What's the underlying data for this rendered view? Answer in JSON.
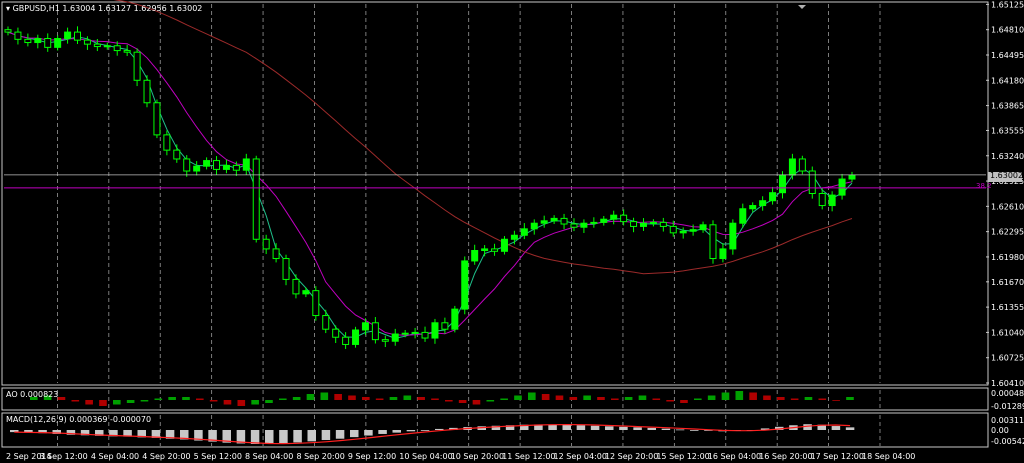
{
  "chart_header": {
    "symbol_label": "GBPUSD,H1",
    "open": "1.63004",
    "high": "1.63127",
    "low": "1.62956",
    "close": "1.63002"
  },
  "price_axis": {
    "ticks": [
      "1.65125",
      "1.64810",
      "1.64495",
      "1.64180",
      "1.63865",
      "1.63555",
      "1.63240",
      "1.62925",
      "1.62610",
      "1.62295",
      "1.61980",
      "1.61670",
      "1.61355",
      "1.61040",
      "1.60725",
      "1.60410"
    ],
    "current_price_label": "1.63002",
    "fib_line_label": "38.2"
  },
  "ao_panel": {
    "label": "AO 0.000823",
    "ticks": [
      "0.000489",
      "-0.012898"
    ]
  },
  "macd_panel": {
    "label": "MACD(12,26,9) 0.000369 -0.000070",
    "ticks": [
      "0.003116",
      "0.00",
      "-0.005422"
    ]
  },
  "time_axis": {
    "labels": [
      "2 Sep 2014",
      "3 Sep 12:00",
      "4 Sep 04:00",
      "4 Sep 20:00",
      "5 Sep 12:00",
      "8 Sep 04:00",
      "8 Sep 20:00",
      "9 Sep 12:00",
      "10 Sep 04:00",
      "10 Sep 20:00",
      "11 Sep 12:00",
      "12 Sep 04:00",
      "12 Sep 20:00",
      "15 Sep 12:00",
      "16 Sep 04:00",
      "16 Sep 20:00",
      "17 Sep 12:00",
      "18 Sep 04:00"
    ]
  },
  "colors": {
    "background": "#000000",
    "bull_candle": "#00ff00",
    "grid": "#9a9a9a",
    "ma_fast": "#1fbf8a",
    "ma_mid": "#c000c0",
    "ma_slow": "#9c2a2a",
    "horizontal_line": "#c000c0",
    "price_line": "#c0c0c0",
    "macd_hist": "#c8c8c8",
    "macd_signal": "#ff2020"
  },
  "chart_data": {
    "type": "candlestick",
    "symbol": "GBPUSD",
    "timeframe": "H1",
    "ylim": [
      1.6041,
      1.6513
    ],
    "close_series": [
      1.6478,
      1.6469,
      1.6465,
      1.647,
      1.6459,
      1.647,
      1.6478,
      1.6468,
      1.6463,
      1.646,
      1.6461,
      1.6455,
      1.6453,
      1.6418,
      1.639,
      1.635,
      1.6331,
      1.632,
      1.6305,
      1.6311,
      1.6318,
      1.6307,
      1.6312,
      1.6306,
      1.632,
      1.622,
      1.6208,
      1.6196,
      1.617,
      1.6152,
      1.6156,
      1.6125,
      1.6108,
      1.6098,
      1.6089,
      1.6107,
      1.6116,
      1.6095,
      1.6093,
      1.6102,
      1.6103,
      1.6104,
      1.6097,
      1.6116,
      1.6108,
      1.6133,
      1.6193,
      1.6206,
      1.6208,
      1.6205,
      1.622,
      1.6225,
      1.6233,
      1.624,
      1.6243,
      1.6246,
      1.6239,
      1.6235,
      1.624,
      1.6241,
      1.6245,
      1.625,
      1.6242,
      1.6236,
      1.624,
      1.6241,
      1.6236,
      1.6228,
      1.623,
      1.6232,
      1.6238,
      1.6196,
      1.6208,
      1.624,
      1.6258,
      1.6262,
      1.6268,
      1.6278,
      1.63,
      1.632,
      1.6305,
      1.6277,
      1.6262,
      1.6275,
      1.6295,
      1.63
    ],
    "lines": [
      {
        "role": "ma_fast"
      },
      {
        "role": "ma_mid"
      },
      {
        "role": "ma_slow"
      }
    ],
    "horizontal_level": 1.6284,
    "current_price": 1.63002,
    "ao_values": [
      0.0002,
      0.0003,
      0.0002,
      -0.0001,
      -0.0003,
      -0.0004,
      -0.0003,
      -0.0002,
      -0.0001,
      0.0001,
      0.0002,
      0.0002,
      0.0001,
      -0.0001,
      -0.0003,
      -0.0004,
      -0.0003,
      -0.0002,
      0.0001,
      0.0002,
      0.0004,
      0.0005,
      0.0004,
      0.0003,
      0.0002,
      0.0001,
      0.0002,
      0.0003,
      0.0002,
      0.0001,
      -0.0001,
      -0.0002,
      -0.0003,
      -0.0001,
      0.0001,
      0.0003,
      0.0005,
      0.0004,
      0.0003,
      0.0002,
      0.0003,
      0.0002,
      0.0001,
      0.0002,
      0.0003,
      0.0001,
      -0.0001,
      -0.0002,
      0.0001,
      0.0003,
      0.0005,
      0.0006,
      0.0005,
      0.0003,
      0.0002,
      0.0001,
      0.0002,
      0.0001,
      0.0,
      0.0002
    ],
    "macd_hist": [
      -0.0008,
      -0.001,
      -0.0012,
      -0.0015,
      -0.0018,
      -0.002,
      -0.0022,
      -0.0024,
      -0.0025,
      -0.0028,
      -0.003,
      -0.0033,
      -0.0036,
      -0.004,
      -0.0044,
      -0.0048,
      -0.0051,
      -0.0053,
      -0.0052,
      -0.005,
      -0.0047,
      -0.0043,
      -0.0038,
      -0.0033,
      -0.0027,
      -0.0021,
      -0.0015,
      -0.001,
      -0.0005,
      0.0,
      0.0004,
      0.0008,
      0.0011,
      0.0014,
      0.0016,
      0.0018,
      0.002,
      0.0021,
      0.0021,
      0.002,
      0.0018,
      0.0016,
      0.0014,
      0.0012,
      0.001,
      0.0008,
      0.0005,
      0.0002,
      0.0,
      -0.0003,
      -0.0005,
      -0.0003,
      0.0,
      0.0006,
      0.0012,
      0.0018,
      0.0022,
      0.002,
      0.0015,
      0.001
    ]
  }
}
